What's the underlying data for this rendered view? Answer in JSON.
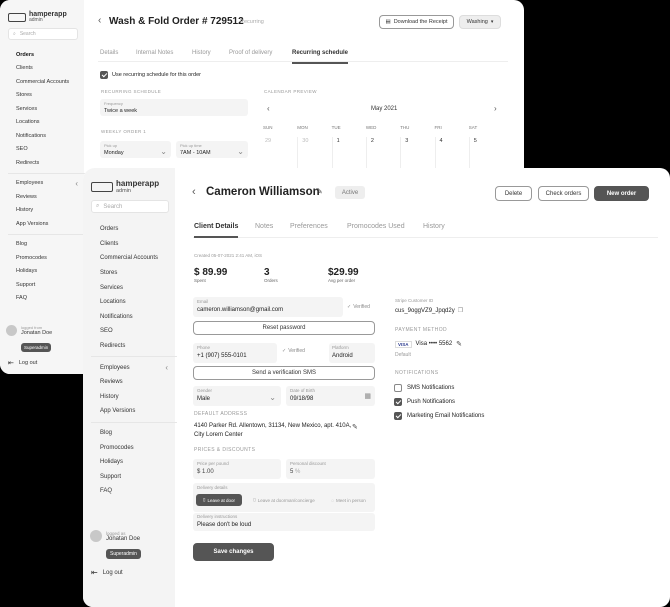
{
  "back": {
    "logo": {
      "name": "hamperapp",
      "sub": "admin"
    },
    "search_placeholder": "Search",
    "nav": [
      "Orders",
      "Clients",
      "Commercial Accounts",
      "Stores",
      "Services",
      "Locations",
      "Notifications",
      "SEO",
      "Redirects"
    ],
    "nav2": [
      "Employees",
      "Reviews",
      "History",
      "App Versions"
    ],
    "nav3": [
      "Blog",
      "Promocodes",
      "Holidays",
      "Support",
      "FAQ"
    ],
    "user": {
      "logged_as": "logged from",
      "name": "Jonatan Doe",
      "role": "Superadmin"
    },
    "logout": "Log out",
    "title": "Wash & Fold Order # 729512",
    "status": "Recurring",
    "download_btn": "Download the Receipt",
    "washing_btn": "Washing",
    "tabs": [
      "Details",
      "Internal Notes",
      "History",
      "Proof of delivery",
      "Recurring schedule"
    ],
    "use_recurring": "Use recurring schedule for this order",
    "recurring_heading": "RECURRING SCHEDULE",
    "calendar_heading": "CALENDAR PREVIEW",
    "frequency_label": "Frequency",
    "frequency_value": "Twice a week",
    "weekly_heading": "WEEKLY ORDER 1",
    "pickup_label": "Pick up",
    "pickup_value": "Monday",
    "time_label": "Pick up time",
    "time_value": "7AM - 10AM",
    "calendar": {
      "month": "May 2021",
      "days": [
        "SUN",
        "MON",
        "TUE",
        "WED",
        "THU",
        "FRI",
        "SAT"
      ],
      "week1": [
        "29",
        "30",
        "1",
        "2",
        "3",
        "4",
        "5"
      ]
    }
  },
  "front": {
    "logo": {
      "name": "hamperapp",
      "sub": "admin"
    },
    "search_placeholder": "Search",
    "nav": [
      "Orders",
      "Clients",
      "Commercial Accounts",
      "Stores",
      "Services",
      "Locations",
      "Notifications",
      "SEO",
      "Redirects"
    ],
    "nav2": [
      "Employees",
      "Reviews",
      "History",
      "App Versions"
    ],
    "nav3": [
      "Blog",
      "Promocodes",
      "Holidays",
      "Support",
      "FAQ"
    ],
    "user": {
      "logged_as": "logged as",
      "name": "Jonatan Doe",
      "role": "Superadmin"
    },
    "logout": "Log out",
    "client_name": "Cameron Williamson",
    "status": "Active",
    "delete_btn": "Delete",
    "check_orders_btn": "Check orders",
    "new_order_btn": "New order",
    "tabs": [
      "Client Details",
      "Notes",
      "Preferences",
      "Promocodes Used",
      "History"
    ],
    "created": "Created 05-07-2021 2:41 AM, iOS",
    "stats": [
      {
        "value": "$ 89.99",
        "label": "Spent"
      },
      {
        "value": "3",
        "label": "Orders"
      },
      {
        "value": "$29.99",
        "label": "Avg per order"
      }
    ],
    "email_label": "Email",
    "email_value": "cameron.williamson@gmail.com",
    "verified": "Verified",
    "reset_btn": "Reset password",
    "phone_label": "Phone",
    "phone_value": "+1 (907) 555-0101",
    "platform_label": "Platform",
    "platform_value": "Android",
    "sms_btn": "Send a verification SMS",
    "gender_label": "Gender",
    "gender_value": "Male",
    "dob_label": "Date of Birth",
    "dob_value": "09/18/98",
    "address_heading": "DEFAULT ADDRESS",
    "address": "4140 Parker Rd. Allentown, 31134, New Mexico, apt. 410A, City Lorem Center",
    "prices_heading": "PRICES & DISCOUNTS",
    "price_label": "Price per pound",
    "price_value": "1.00",
    "discount_label": "Personal discount",
    "discount_value": "5",
    "delivery_label": "Delivery details",
    "delivery_options": [
      "Leave at door",
      "Leave at doorman/concierge",
      "Meet in person"
    ],
    "instructions_label": "Delivery instructions",
    "instructions_value": "Please don't be loud",
    "save_btn": "Save changes",
    "stripe_label": "Stripe Customer ID",
    "stripe_value": "cus_9oggVZ9_Jpqd2y",
    "payment_heading": "PAYMENT METHOD",
    "card_brand": "VISA",
    "card_text": "Visa •••• 5562",
    "card_default": "Default",
    "notifications_heading": "NOTIFICATIONS",
    "notifications": [
      {
        "label": "SMS Notifications",
        "on": false
      },
      {
        "label": "Push Notifications",
        "on": true
      },
      {
        "label": "Marketing Email Notifications",
        "on": true
      }
    ]
  }
}
